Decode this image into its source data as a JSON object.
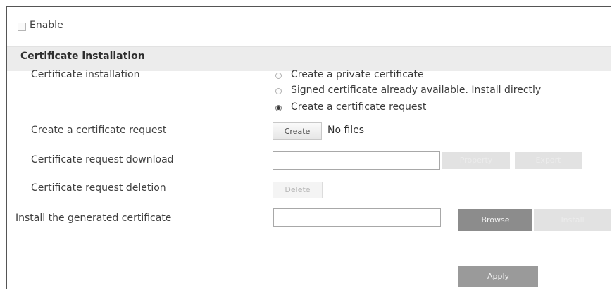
{
  "enable": {
    "label": "Enable",
    "checked": false
  },
  "section": {
    "title": "Certificate installation"
  },
  "certificate_installation": {
    "label": "Certificate installation",
    "options": [
      {
        "label": "Create a private certificate",
        "selected": false
      },
      {
        "label": "Signed certificate already available. Install directly",
        "selected": false
      },
      {
        "label": "Create a certificate request",
        "selected": true
      }
    ]
  },
  "create_request": {
    "label": "Create a certificate request",
    "button": "Create",
    "status": "No files"
  },
  "request_download": {
    "label": "Certificate request download",
    "value": "",
    "property_button": "Property",
    "export_button": "Export"
  },
  "request_deletion": {
    "label": "Certificate request deletion",
    "button": "Delete"
  },
  "install_generated": {
    "label": "Install the generated certificate",
    "value": "",
    "browse_button": "Browse",
    "install_button": "Install"
  },
  "apply_button": "Apply",
  "colors": {
    "section_band": "#ececec",
    "dark_button": "#8c8c8c",
    "disabled_button": "#e2e2e2"
  }
}
